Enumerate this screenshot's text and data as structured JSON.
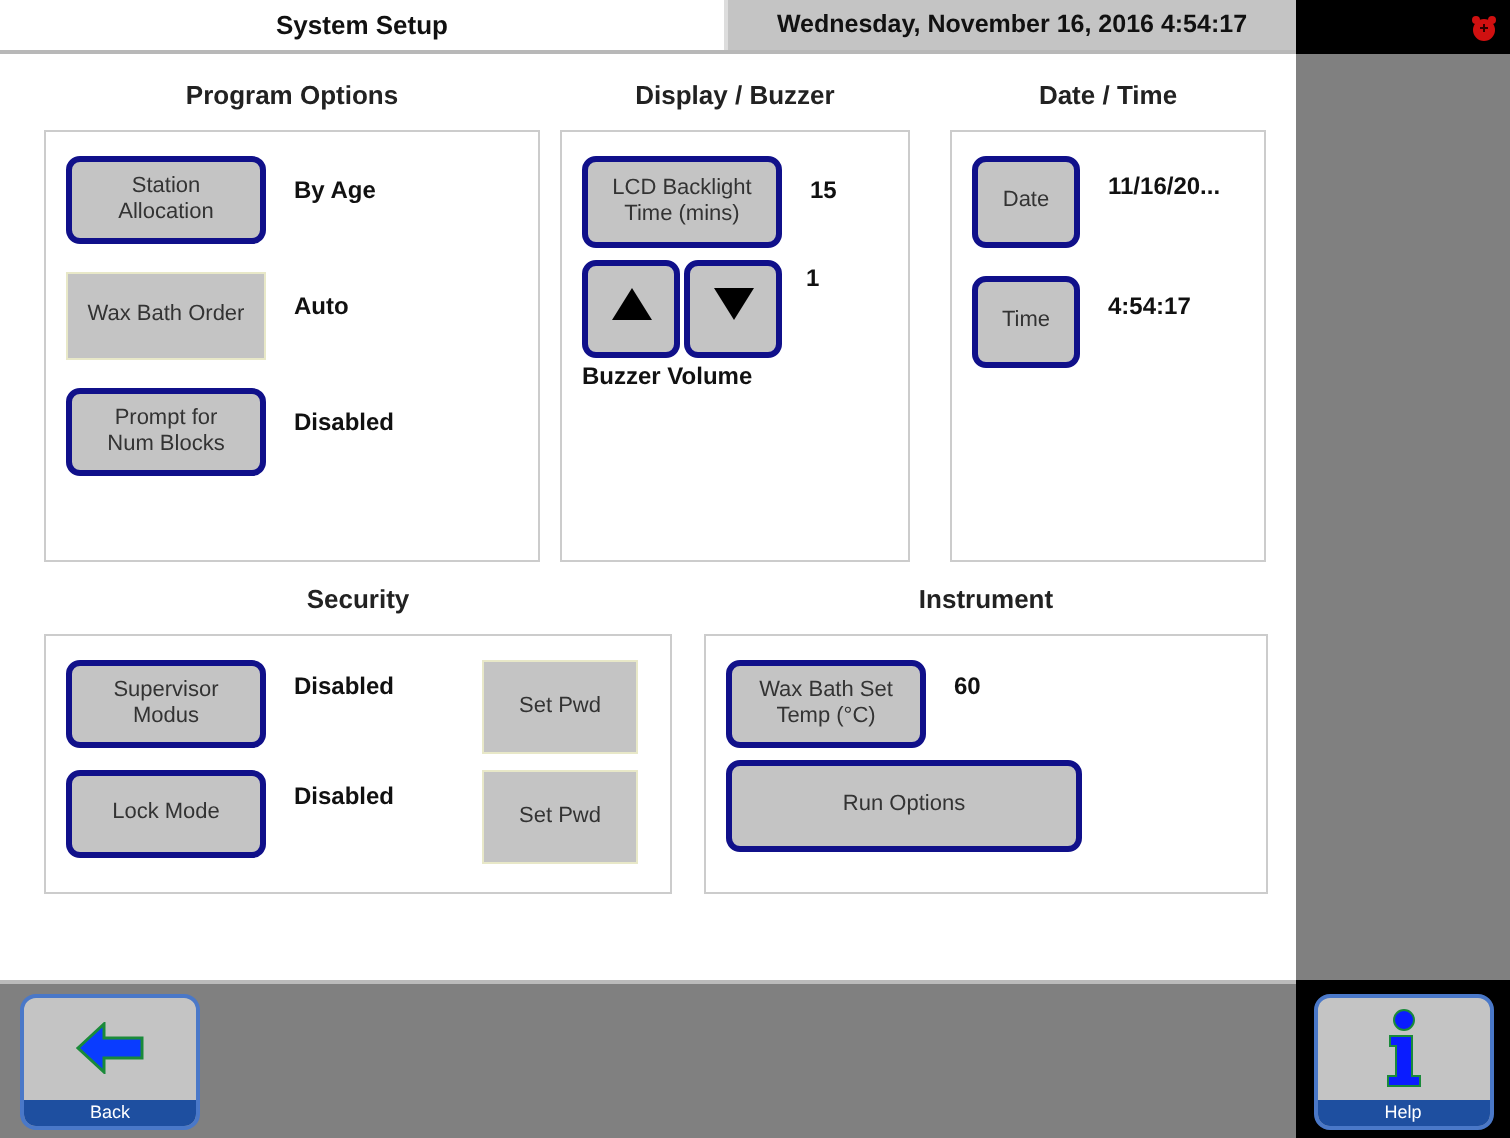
{
  "title": "System Setup",
  "datetime": "Wednesday, November 16, 2016 4:54:17",
  "program_options": {
    "heading": "Program Options",
    "rows": [
      {
        "button": "Station\nAllocation",
        "disabled": false,
        "value": "By Age"
      },
      {
        "button": "Wax Bath Order",
        "disabled": true,
        "value": "Auto"
      },
      {
        "button": "Prompt for\nNum Blocks",
        "disabled": false,
        "value": "Disabled"
      }
    ]
  },
  "display_buzzer": {
    "heading": "Display / Buzzer",
    "backlight_button": "LCD Backlight\nTime (mins)",
    "backlight_value": "15",
    "volume_value": "1",
    "volume_label": "Buzzer Volume"
  },
  "date_time": {
    "heading": "Date / Time",
    "rows": [
      {
        "button": "Date",
        "disabled": false,
        "value": "11/16/20..."
      },
      {
        "button": "Time",
        "disabled": false,
        "value": "4:54:17"
      }
    ]
  },
  "security": {
    "heading": "Security",
    "rows": [
      {
        "button": "Supervisor\nModus",
        "disabled": false,
        "value": "Disabled",
        "pwd_button": "Set Pwd",
        "pwd_disabled": true
      },
      {
        "button": "Lock Mode",
        "disabled": false,
        "value": "Disabled",
        "pwd_button": "Set Pwd",
        "pwd_disabled": true
      }
    ]
  },
  "instrument": {
    "heading": "Instrument",
    "temp_button": "Wax Bath Set\nTemp (°C)",
    "temp_value": "60",
    "run_button": "Run Options"
  },
  "footer": {
    "back": "Back",
    "help": "Help"
  }
}
